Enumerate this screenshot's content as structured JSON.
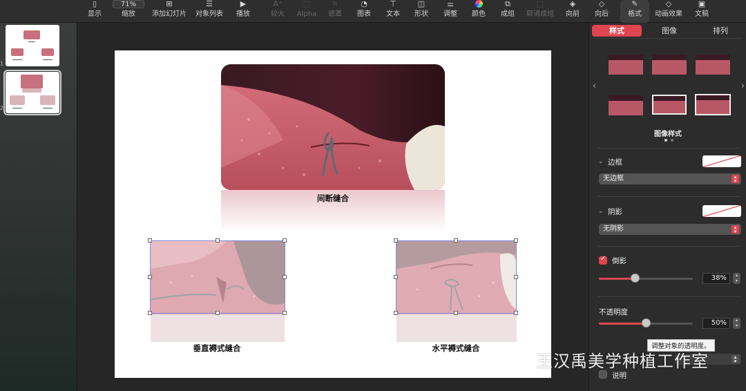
{
  "toolbar": {
    "items": [
      {
        "label": "显示",
        "icon": "sidebar-icon"
      },
      {
        "label": "缩放",
        "icon": "zoom-icon",
        "value": "71%"
      },
      {
        "label": "添加幻灯片",
        "icon": "add-slide-icon"
      },
      {
        "label": "对象列表",
        "icon": "list-icon"
      },
      {
        "label": "播放",
        "icon": "play-icon"
      },
      {
        "label": "较大",
        "icon": "font-larger-icon"
      },
      {
        "label": "Alpha",
        "icon": "alpha-icon"
      },
      {
        "label": "遮罩",
        "icon": "mask-icon"
      },
      {
        "label": "图表",
        "icon": "chart-icon"
      },
      {
        "label": "文本",
        "icon": "text-icon"
      },
      {
        "label": "形状",
        "icon": "shape-icon"
      },
      {
        "label": "调整",
        "icon": "adjust-icon"
      },
      {
        "label": "颜色",
        "icon": "color-wheel-icon"
      },
      {
        "label": "成组",
        "icon": "group-icon"
      },
      {
        "label": "取消成组",
        "icon": "ungroup-icon"
      },
      {
        "label": "向前",
        "icon": "bring-forward-icon"
      },
      {
        "label": "向后",
        "icon": "send-backward-icon"
      },
      {
        "label": "格式",
        "icon": "format-brush-icon"
      },
      {
        "label": "动画效果",
        "icon": "animate-icon"
      },
      {
        "label": "文稿",
        "icon": "document-icon"
      }
    ]
  },
  "sidebar": {
    "slides": [
      {
        "number": "1",
        "label_top": "间断缝合"
      },
      {
        "number": "2"
      }
    ]
  },
  "slide": {
    "captions": {
      "top": "间断缝合",
      "left": "垂直褥式缝合",
      "right": "水平褥式缝合"
    }
  },
  "inspector": {
    "tabs": [
      "样式",
      "图像",
      "排列"
    ],
    "image_styles_label": "图像样式",
    "border": {
      "title": "边框",
      "value": "无边框"
    },
    "shadow": {
      "title": "阴影",
      "value": "无阴影"
    },
    "reflection": {
      "title": "倒影",
      "checked": true,
      "value": "38%",
      "level": 0.38
    },
    "opacity": {
      "title": "不透明度",
      "value": "50%",
      "level": 0.5
    },
    "tooltip": "调整对象的透明度。",
    "caption": {
      "title": "说明",
      "checked": false
    }
  },
  "watermark": "王汉禹美学种植工作室",
  "colors": {
    "accent": "#e0454f",
    "selection": "#7c8bd9",
    "tissue": "#c95d6a"
  }
}
